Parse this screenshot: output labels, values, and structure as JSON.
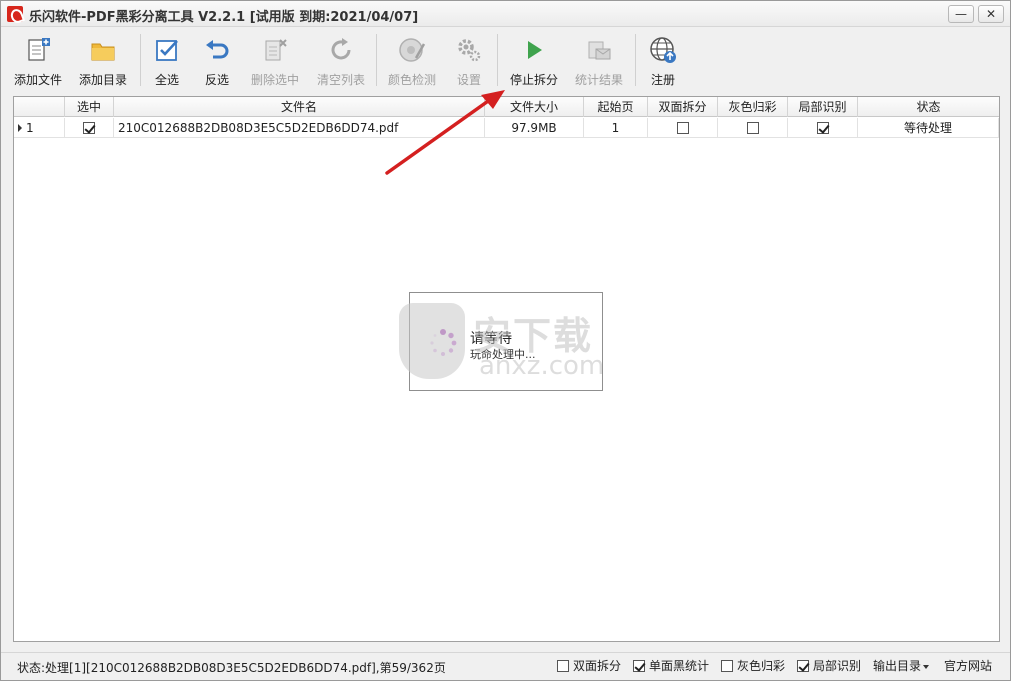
{
  "window": {
    "title": "乐闪软件-PDF黑彩分离工具 V2.2.1 [试用版 到期:2021/04/07]",
    "minimize": "—",
    "close": "✕"
  },
  "toolbar": {
    "add_file": "添加文件",
    "add_dir": "添加目录",
    "select_all": "全选",
    "invert": "反选",
    "delete_selected": "删除选中",
    "clear_list": "清空列表",
    "color_detect": "颜色检测",
    "settings": "设置",
    "stop_split": "停止拆分",
    "statistics": "统计结果",
    "register": "注册"
  },
  "grid": {
    "columns": [
      "",
      "选中",
      "文件名",
      "文件大小",
      "起始页",
      "双面拆分",
      "灰色归彩",
      "局部识别",
      "状态"
    ],
    "rows": [
      {
        "index": "1",
        "selected": true,
        "filename": "210C012688B2DB08D3E5C5D2EDB6DD74.pdf",
        "size": "97.9MB",
        "start_page": "1",
        "duplex": false,
        "gray": false,
        "local": true,
        "status": "等待处理"
      }
    ]
  },
  "wait": {
    "title": "请等待",
    "subtitle": "玩命处理中..."
  },
  "watermark": {
    "cn": "安下载",
    "en": "anxz.com"
  },
  "statusbar": {
    "text": "状态:处理[1][210C012688B2DB08D3E5C5D2EDB6DD74.pdf],第59/362页",
    "duplex": "双面拆分",
    "single_black": "单面黑统计",
    "gray": "灰色归彩",
    "local": "局部识别",
    "output_dir": "输出目录",
    "website": "官方网站"
  },
  "colors": {
    "accent_blue": "#3a78c2",
    "arrow_red": "#d42020",
    "folder_yellow": "#f0b93a",
    "play_green": "#3fa34d"
  }
}
